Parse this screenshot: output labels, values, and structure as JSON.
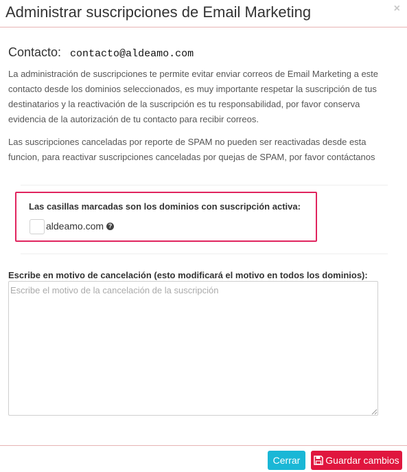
{
  "modal": {
    "title": "Administrar suscripciones de Email Marketing",
    "close_symbol": "×"
  },
  "contact": {
    "label": "Contacto:",
    "email": "contacto@aldeamo.com"
  },
  "description": {
    "paragraph1": "La administración de suscripciones te permite evitar enviar correos de Email Marketing a este contacto desde los dominios seleccionados, es muy importante respetar la suscripción de tus destinatarios y la reactivación de la suscripción es tu responsabilidad, por favor conserva evidencia de la autorización de tu contacto para recibir correos.",
    "paragraph2": "Las suscripciones canceladas por reporte de SPAM no pueden ser reactivadas desde esta funcion, para reactivar suscripciones canceladas por quejas de SPAM, por favor contáctanos"
  },
  "domains": {
    "heading": "Las casillas marcadas son los dominios con suscripción activa:",
    "items": [
      {
        "name": "aldeamo.com",
        "checked": false,
        "help_icon": "question-circle-icon"
      }
    ],
    "highlight_color": "#e0245e"
  },
  "reason": {
    "label": "Escribe en motivo de cancelación (esto modificará el motivo en todos los dominios):",
    "placeholder": "Escribe el motivo de la cancelación de la suscripción",
    "value": ""
  },
  "footer": {
    "cancel_label": "Cerrar",
    "save_label": "Guardar cambios",
    "save_icon": "save-icon",
    "cancel_color": "#1ab7d6",
    "save_color": "#e0163e"
  }
}
